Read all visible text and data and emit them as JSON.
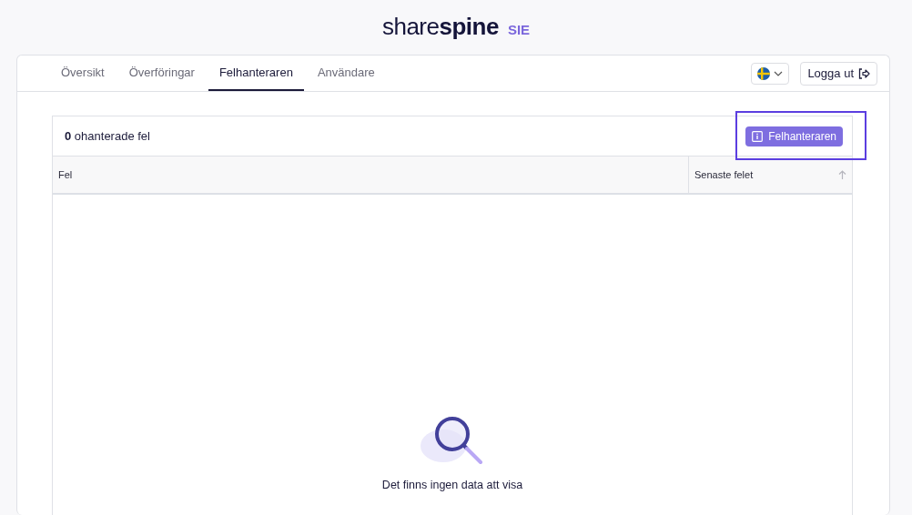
{
  "logo": {
    "text": "share**spine**",
    "badge": "SIE"
  },
  "tabs": [
    {
      "label": "Översikt",
      "selected": false
    },
    {
      "label": "Överföringar",
      "selected": false
    },
    {
      "label": "Felhanteraren",
      "selected": true
    },
    {
      "label": "Användare",
      "selected": false
    }
  ],
  "logout": {
    "label": "Logga ut"
  },
  "errors": {
    "count": "0",
    "summary": "ohanterade fel",
    "button": "Felhanteraren",
    "highlighted": true
  },
  "table": {
    "columns": [
      {
        "label": "Fel",
        "sorted": false
      },
      {
        "label": "Senaste felet",
        "sorted": true
      }
    ],
    "empty_message": "Det finns ingen data att visa"
  }
}
